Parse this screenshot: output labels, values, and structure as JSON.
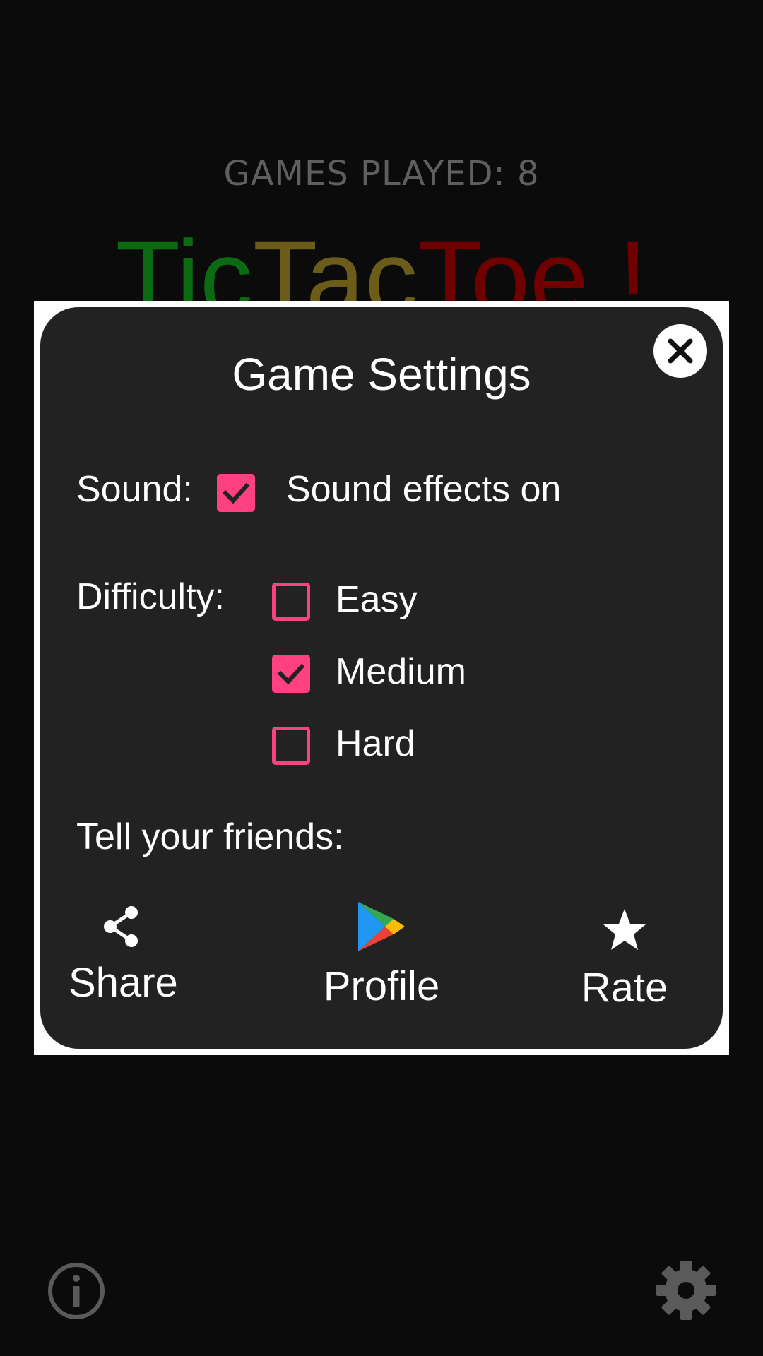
{
  "stats": {
    "games_played": "GAMES PLAYED: 8"
  },
  "title": {
    "tic": "Tic",
    "tac": "Tac",
    "toe": "Toe",
    "bang": " !"
  },
  "dialog": {
    "title": "Game Settings",
    "sound": {
      "label": "Sound:",
      "checked": true,
      "option_label": "Sound effects on"
    },
    "difficulty": {
      "label": "Difficulty:",
      "options": [
        {
          "label": "Easy",
          "checked": false
        },
        {
          "label": "Medium",
          "checked": true
        },
        {
          "label": "Hard",
          "checked": false
        }
      ]
    },
    "friends": {
      "label": "Tell your friends:",
      "actions": [
        {
          "label": "Share",
          "icon": "share-icon"
        },
        {
          "label": "Profile",
          "icon": "google-play-icon"
        },
        {
          "label": "Rate",
          "icon": "star-icon"
        }
      ]
    }
  },
  "colors": {
    "accent": "#ff4081",
    "tic": "#0c6b12",
    "tac": "#6b5d19",
    "toe": "#6e0000",
    "dialog_bg": "#222222",
    "screen_bg": "#0b0b0b"
  }
}
